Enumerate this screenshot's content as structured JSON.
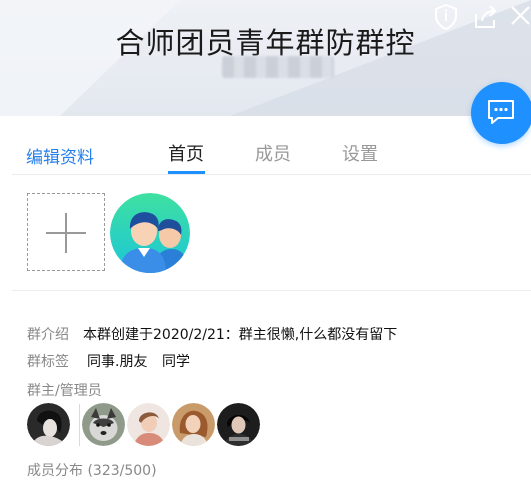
{
  "colors": {
    "accent": "#1e90ff",
    "link": "#2680eb",
    "header_bg": "#e6eaf0"
  },
  "header": {
    "group_name": "合师团员青年群防群控",
    "icons": [
      "shield-icon",
      "share-icon",
      "close-icon"
    ]
  },
  "chat_button": {
    "icon": "chat-bubble-icon"
  },
  "tabs": {
    "edit_label": "编辑资料",
    "items": [
      {
        "label": "首页",
        "active": true
      },
      {
        "label": "成员",
        "active": false
      },
      {
        "label": "设置",
        "active": false
      }
    ]
  },
  "media": {
    "add_icon": "plus-icon",
    "group_avatar_icon": "two-people-avatar-icon"
  },
  "info": {
    "intro_label": "群介绍",
    "intro_value": "本群创建于2020/2/21：群主很懒,什么都没有留下",
    "tags_label": "群标签",
    "tags": [
      "同事.朋友",
      "同学"
    ],
    "admins_label": "群主/管理员",
    "distribution_label": "成员分布",
    "distribution_count": "(323/500)"
  }
}
